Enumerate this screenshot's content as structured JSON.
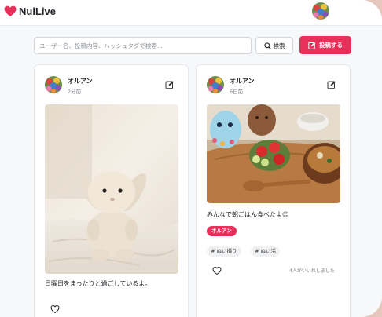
{
  "app": {
    "name": "NuiLive",
    "brand_color": "#e8305a"
  },
  "header": {
    "logo_icon": "heart-icon",
    "avatar_icon": "user-avatar"
  },
  "search": {
    "placeholder": "ユーザー名、投稿内容、ハッシュタグで検索...",
    "value": "",
    "button_label": "検索",
    "button_icon": "search-icon"
  },
  "actions": {
    "post_label": "投稿する",
    "post_icon": "edit-square-icon"
  },
  "posts": [
    {
      "username": "オルアン",
      "time": "2分前",
      "image": "white plush bunny sitting on a bed",
      "caption": "日曜日をまったりと過ごしているよ。"
    },
    {
      "username": "オルアン",
      "time": "6日前",
      "image": "plush toys at a breakfast table with tomatoes and miso soup",
      "caption": "みんなで朝ごはん食べたよ😊",
      "tag": "オルアン",
      "hashtags": [
        "# ぬい撮り",
        "# ぬい活"
      ],
      "likes": "4人がいいねしました"
    }
  ]
}
